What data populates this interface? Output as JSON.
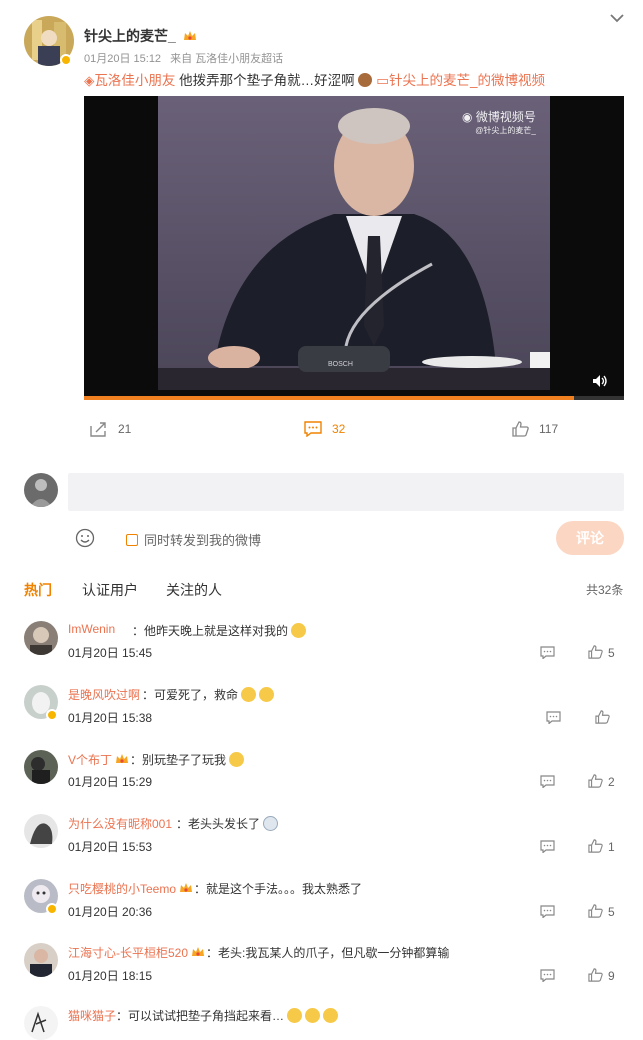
{
  "post": {
    "author": "针尖上的麦芒_",
    "time": "01月20日 15:12",
    "source": "来自 瓦洛佳小朋友超话",
    "topic": "瓦洛佳小朋友",
    "text": "他拨弄那个垫子角就…好涩啊",
    "link_text": "针尖上的麦芒_的微博视频",
    "watermark_main": "微博视频号",
    "watermark_sub": "@针尖上的麦芒_",
    "mic_brand": "BOSCH",
    "reposts": "21",
    "comments": "32",
    "likes": "117"
  },
  "composer": {
    "repost_label": "同时转发到我的微博",
    "submit_label": "评论"
  },
  "tabs": {
    "hot": "热门",
    "verified": "认证用户",
    "following": "关注的人",
    "total": "共32条"
  },
  "comments": [
    {
      "name": "ImWenin",
      "text": "他昨天晚上就是这样对我的",
      "time": "01月20日 15:45",
      "likes": "5"
    },
    {
      "name": "是晚风吹过啊",
      "text": "可爱死了，救命",
      "time": "01月20日 15:38",
      "likes": ""
    },
    {
      "name": "V个布丁",
      "text": "别玩垫子了玩我",
      "time": "01月20日 15:29",
      "likes": "2"
    },
    {
      "name": "为什么没有昵称001",
      "text": "老头头发长了",
      "time": "01月20日 15:53",
      "likes": "1"
    },
    {
      "name": "只吃樱桃的小Teemo",
      "text": "就是这个手法。。。我太熟悉了",
      "time": "01月20日 20:36",
      "likes": "5"
    },
    {
      "name": "江海寸心-长平桓柜520",
      "text": "老头:我瓦某人的爪子，但凡歇一分钟都算输",
      "time": "01月20日 18:15",
      "likes": "9"
    },
    {
      "name": "猫咪猫子",
      "text": "可以试试把垫子角挡起来看…",
      "time": "",
      "likes": ""
    }
  ],
  "colors": {
    "accent_orange": "#eb7350",
    "tab_active": "#f18200",
    "button_bg": "#fbd6c3",
    "input_bg": "#f2f2f5",
    "video_bg": "#5a526a"
  },
  "icons": [
    "chevron-down-icon",
    "repost-icon",
    "comment-icon",
    "like-icon",
    "volume-icon",
    "emoji-icon",
    "checkbox-icon",
    "reply-icon"
  ]
}
